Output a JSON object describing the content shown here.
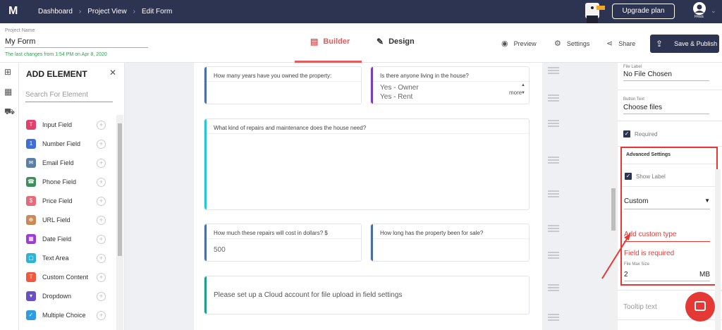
{
  "topbar": {
    "logo": "M",
    "breadcrumbs": [
      "Dashboard",
      "Project View",
      "Edit Form"
    ],
    "upgrade_label": "Upgrade plan",
    "plan_badge": "FREE"
  },
  "project": {
    "name_label": "Project Name",
    "name_value": "My Form",
    "last_changes": "The last changes from 1:54 PM on Apr 8, 2020"
  },
  "tabs": {
    "builder": "Builder",
    "design": "Design"
  },
  "actions": {
    "preview": "Preview",
    "settings": "Settings",
    "share": "Share",
    "publish": "Save & Publish"
  },
  "add_panel": {
    "title": "ADD ELEMENT",
    "search_placeholder": "Search For Element",
    "elements": [
      {
        "label": "Input Field",
        "color": "#e53e6b",
        "glyph": "T"
      },
      {
        "label": "Number Field",
        "color": "#3f6ed8",
        "glyph": "1"
      },
      {
        "label": "Email Field",
        "color": "#5a7fa6",
        "glyph": "✉"
      },
      {
        "label": "Phone Field",
        "color": "#3c8f5a",
        "glyph": "☎"
      },
      {
        "label": "Price Field",
        "color": "#e56b7a",
        "glyph": "$"
      },
      {
        "label": "URL Field",
        "color": "#c98a5a",
        "glyph": "⊕"
      },
      {
        "label": "Date Field",
        "color": "#9c3fd0",
        "glyph": "▦"
      },
      {
        "label": "Text Area",
        "color": "#29b6d6",
        "glyph": "▢"
      },
      {
        "label": "Custom Content",
        "color": "#f0593e",
        "glyph": "T"
      },
      {
        "label": "Dropdown",
        "color": "#6a4fc7",
        "glyph": "▾"
      },
      {
        "label": "Multiple Choice",
        "color": "#2f9be0",
        "glyph": "✓"
      }
    ]
  },
  "form": {
    "q1": "How many years have you owned the property:",
    "q2": "Is there anyone living in the house?",
    "q2_options": [
      "Yes - Owner",
      "Yes - Rent"
    ],
    "q2_more": "more",
    "q3": "What kind of repairs and maintenance does the house need?",
    "q4": "How much these repairs will cost in dollars? $",
    "q4_value": "500",
    "q5": "How long has the property been for sale?",
    "upload_notice": "Please set up a Cloud account for file upload in field settings",
    "colors": {
      "blue": "#4a6fa5",
      "purple": "#7b3fb3",
      "teal": "#26c6da",
      "green": "#1f9e8f"
    }
  },
  "settings_panel": {
    "file_label_caption": "File Label",
    "file_label_value": "No File Chosen",
    "button_text_caption": "Button Text",
    "button_text_value": "Choose files",
    "required_label": "Required",
    "advanced_title": "Advanced Settings",
    "show_label": "Show Label",
    "select_value": "Custom",
    "custom_type_placeholder": "Add custom type",
    "error_text": "Field is required",
    "max_size_caption": "File Max Size",
    "max_size_value": "2",
    "max_size_unit": "MB",
    "tooltip_placeholder": "Tooltip text"
  }
}
